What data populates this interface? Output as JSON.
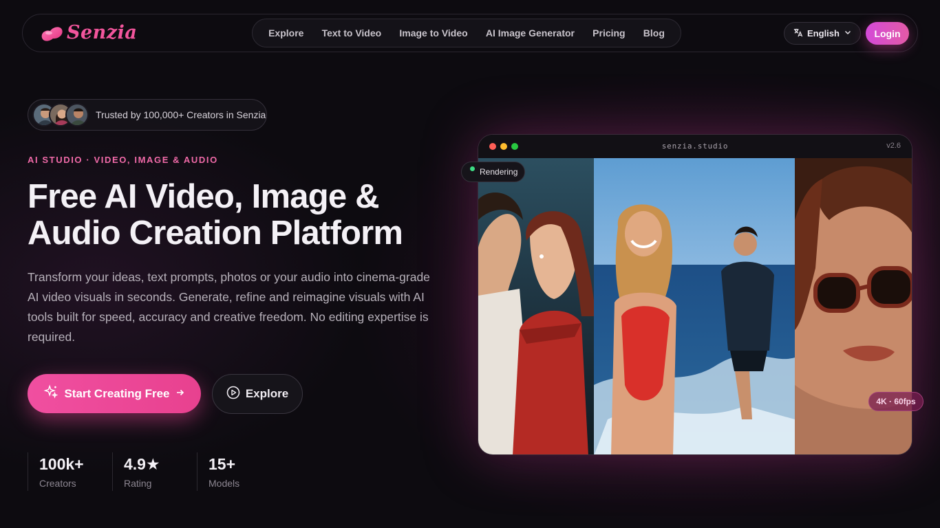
{
  "brand": {
    "name": "Senzia",
    "color": "#f2559c"
  },
  "nav": {
    "links": [
      "Explore",
      "Text to Video",
      "Image to Video",
      "AI Image Generator",
      "Pricing",
      "Blog"
    ],
    "language": "English",
    "login": "Login"
  },
  "hero": {
    "trust_text": "Trusted by 100,000+ Creators in Senzia",
    "eyebrow": "AI STUDIO · VIDEO, IMAGE & AUDIO",
    "headline_line1": "Free AI Video, Image &",
    "headline_line2": "Audio Creation Platform",
    "description": "Transform your ideas, text prompts, photos or your audio into cinema-grade AI video visuals in seconds. Generate, refine and reimagine visuals with AI tools built for speed, accuracy and creative freedom. No editing expertise is required.",
    "primary_cta": "Start Creating Free",
    "secondary_cta": "Explore"
  },
  "stats": [
    {
      "value": "100k+",
      "label": "Creators"
    },
    {
      "value": "4.9★",
      "label": "Rating"
    },
    {
      "value": "15+",
      "label": "Models"
    }
  ],
  "preview": {
    "url": "senzia.studio",
    "version": "v2.6",
    "status": "Rendering",
    "quality_badge": "4K · 60fps",
    "status_color": "#3ddc84"
  },
  "colors": {
    "accent": "#f04fa0",
    "login_gradient_start": "#d44ad8",
    "background": "#0d0b10"
  }
}
